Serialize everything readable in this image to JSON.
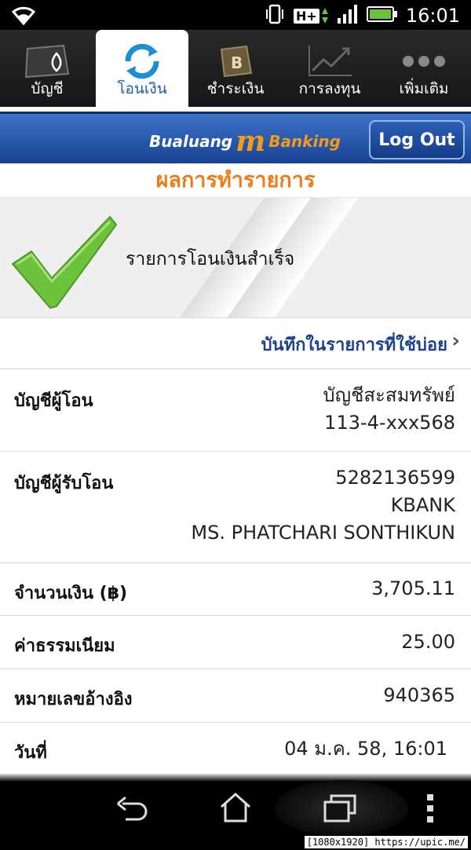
{
  "status_bar": {
    "time": "16:01",
    "network": "H+"
  },
  "tabs": [
    {
      "label": "บัญชี",
      "icon": "account-icon"
    },
    {
      "label": "โอนเงิน",
      "icon": "transfer-icon"
    },
    {
      "label": "ชำระเงิน",
      "icon": "payment-icon"
    },
    {
      "label": "การลงทุน",
      "icon": "investment-icon"
    },
    {
      "label": "เพิ่มเติม",
      "icon": "more-icon"
    }
  ],
  "header": {
    "logo_left": "Bualuang",
    "logo_m": "m",
    "logo_right": "Banking",
    "logout": "Log Out"
  },
  "page_title": "ผลการทำรายการ",
  "result": {
    "message": "รายการโอนเงินสำเร็จ"
  },
  "favorite_link": "บันทึกในรายการที่ใช้บ่อย",
  "details": {
    "from": {
      "label": "บัญชีผู้โอน",
      "line1": "บัญชีสะสมทรัพย์",
      "line2": "113-4-xxx568"
    },
    "to": {
      "label": "บัญชีผู้รับโอน",
      "line1": "5282136599",
      "line2": "KBANK",
      "line3": "MS. PHATCHARI SONTHIKUN"
    },
    "amount": {
      "label": "จำนวนเงิน (฿)",
      "value": "3,705.11"
    },
    "fee": {
      "label": "ค่าธรรมเนียม",
      "value": "25.00"
    },
    "ref": {
      "label": "หมายเลขอ้างอิง",
      "value": "940365"
    },
    "date": {
      "label": "วันที่",
      "value": "04 ม.ค. 58, 16:01"
    }
  },
  "watermark": "[1080x1920] https://upic.me/",
  "colors": {
    "accent_orange": "#ef7b17",
    "header_blue": "#1d4c9f",
    "link_blue": "#1d3f8e",
    "check_green": "#6cc23a"
  }
}
